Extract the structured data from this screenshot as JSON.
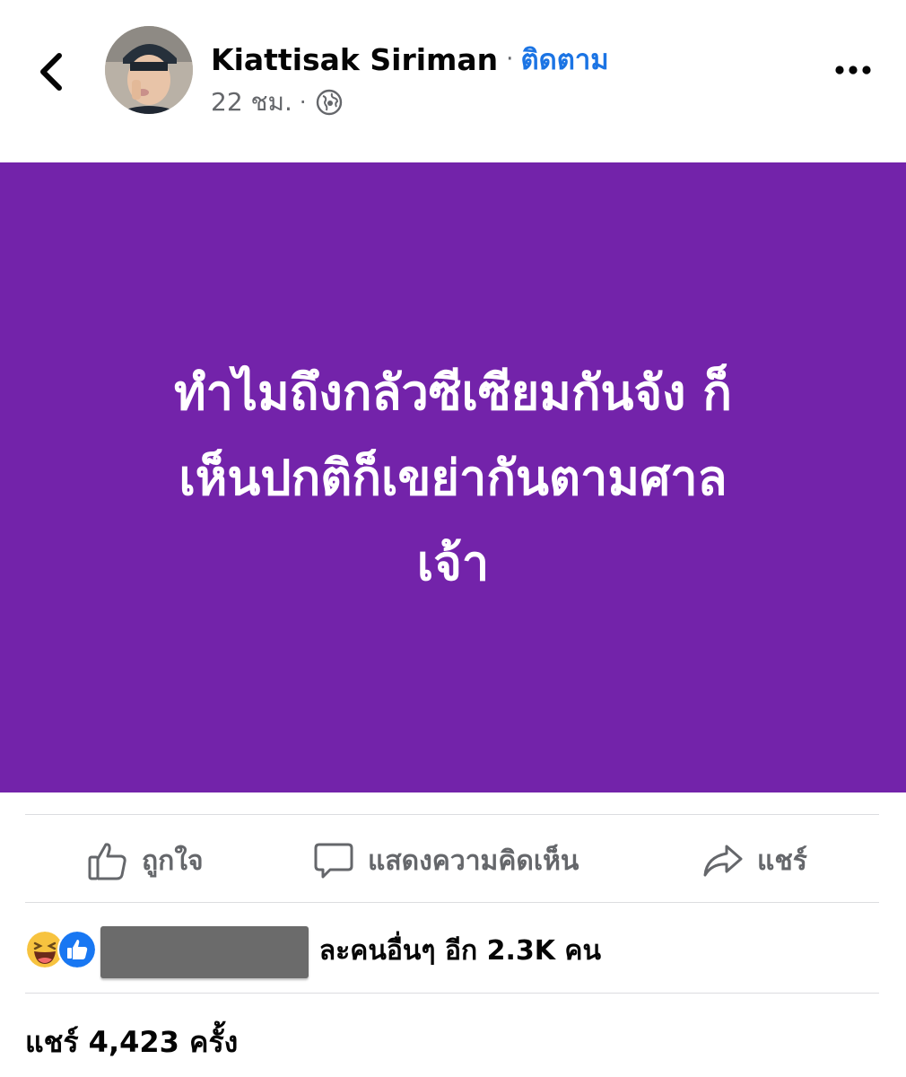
{
  "header": {
    "back_icon": "chevron-left-icon",
    "author_name": "Kiattisak Siriman",
    "separator": "·",
    "follow_label": "ติดตาม",
    "post_time": "22 ชม.",
    "time_separator": "·",
    "audience_icon": "globe-icon",
    "more_icon": "more-horizontal-icon"
  },
  "post": {
    "background_color": "#7323aa",
    "text_color": "#ffffff",
    "lines": [
      "ทำไมถึงกลัวซีเซียมกันจัง ก็",
      "เห็นปกติก็เขย่ากันตามศาล",
      "เจ้า"
    ]
  },
  "actions": {
    "like_label": "ถูกใจ",
    "comment_label": "แสดงความคิดเห็น",
    "share_label": "แชร์"
  },
  "reactions": {
    "icons": [
      "laugh-reaction-icon",
      "like-reaction-icon"
    ],
    "summary_text": "ละคนอื่นๆ อีก 2.3K คน"
  },
  "shares": {
    "text": "แชร์ 4,423 ครั้ง"
  },
  "colors": {
    "accent": "#1b74e4",
    "secondary_text": "#65676b"
  }
}
